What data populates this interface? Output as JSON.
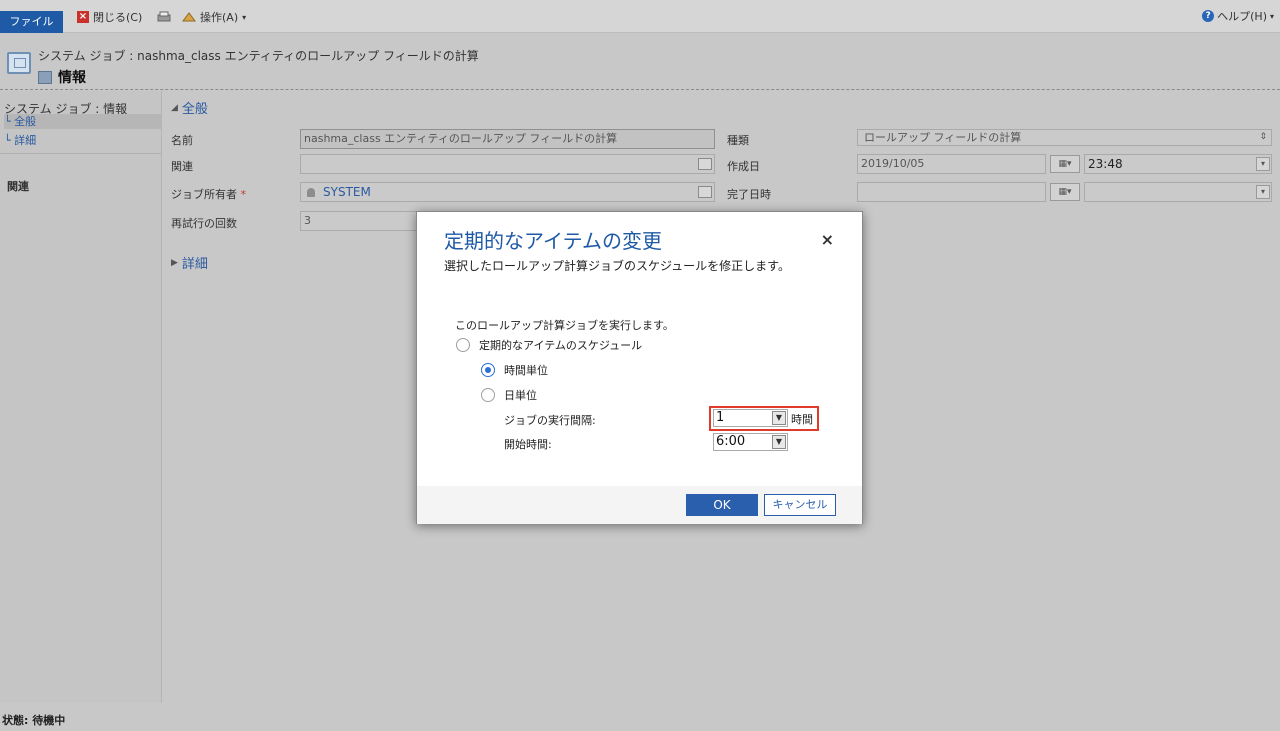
{
  "ribbon": {
    "file_tab": "ファイル",
    "close_label": "閉じる(C)",
    "actions_label": "操作(A)",
    "help_label": "ヘルプ(H)"
  },
  "header": {
    "breadcrumb": "システム ジョブ : nashma_class エンティティのロールアップ フィールドの計算",
    "title": "情報"
  },
  "leftnav": {
    "heading": "システム ジョブ : 情報",
    "items": [
      {
        "label": "全般"
      },
      {
        "label": "詳細"
      }
    ],
    "related": "関連"
  },
  "form": {
    "section_general": "全般",
    "section_details": "詳細",
    "fields": {
      "name_label": "名前",
      "name_value": "nashma_class エンティティのロールアップ フィールドの計算",
      "related_label": "関連",
      "owner_label": "ジョブ所有者",
      "owner_required": "*",
      "owner_value": "SYSTEM",
      "retry_label": "再試行の回数",
      "retry_value": "3",
      "type_label": "種類",
      "type_value": "ロールアップ フィールドの計算",
      "created_label": "作成日",
      "created_date": "2019/10/05",
      "created_time": "23:48",
      "completed_label": "完了日時"
    }
  },
  "status": {
    "text": "状態: 待機中"
  },
  "dialog": {
    "title": "定期的なアイテムの変更",
    "subtitle": "選択したロールアップ計算ジョブのスケジュールを修正します。",
    "instruction": "このロールアップ計算ジョブを実行します。",
    "radio_recurring": "定期的なアイテムのスケジュール",
    "radio_hourly": "時間単位",
    "radio_daily": "日単位",
    "interval_label": "ジョブの実行間隔:",
    "interval_value": "1",
    "interval_unit": "時間",
    "start_label": "開始時間:",
    "start_value": "6:00",
    "ok_label": "OK",
    "cancel_label": "キャンセル",
    "close_glyph": "×"
  }
}
